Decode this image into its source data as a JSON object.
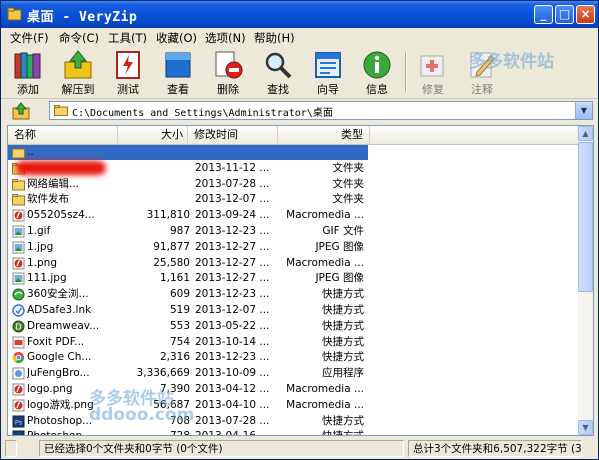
{
  "window": {
    "title": "桌面 - VeryZip"
  },
  "menu": [
    "文件(F)",
    "命令(C)",
    "工具(T)",
    "收藏(O)",
    "选项(N)",
    "帮助(H)"
  ],
  "toolbar": [
    {
      "label": "添加",
      "icon": "add-books-icon"
    },
    {
      "label": "解压到",
      "icon": "extract-folder-icon"
    },
    {
      "label": "测试",
      "icon": "test-icon"
    },
    {
      "label": "查看",
      "icon": "view-book-icon"
    },
    {
      "label": "删除",
      "icon": "delete-icon"
    },
    {
      "label": "查找",
      "icon": "find-magnifier-icon"
    },
    {
      "label": "向导",
      "icon": "wizard-icon"
    },
    {
      "label": "信息",
      "icon": "info-icon"
    },
    {
      "label": "修复",
      "icon": "repair-icon"
    },
    {
      "label": "注释",
      "icon": "comment-icon"
    }
  ],
  "address": {
    "path": "C:\\Documents and Settings\\Administrator\\桌面"
  },
  "columns": {
    "name": "名称",
    "size": "大小",
    "modified": "修改时间",
    "type": "类型"
  },
  "files": [
    {
      "name": "..",
      "size": "",
      "time": "",
      "type": "",
      "icon": "parent-folder-icon"
    },
    {
      "name": "",
      "size": "",
      "time": "2013-11-12 ...",
      "type": "文件夹",
      "icon": "folder-icon"
    },
    {
      "name": "网络编辑...",
      "size": "",
      "time": "2013-07-28 ...",
      "type": "文件夹",
      "icon": "folder-icon"
    },
    {
      "name": "软件发布",
      "size": "",
      "time": "2013-12-07 ...",
      "type": "文件夹",
      "icon": "folder-icon"
    },
    {
      "name": "055205sz4...",
      "size": "311,810",
      "time": "2013-09-24 ...",
      "type": "Macromedia ...",
      "icon": "flash-icon"
    },
    {
      "name": "1.gif",
      "size": "987",
      "time": "2013-12-23 ...",
      "type": "GIF 文件",
      "icon": "image-icon"
    },
    {
      "name": "1.jpg",
      "size": "91,877",
      "time": "2013-12-27 ...",
      "type": "JPEG 图像",
      "icon": "image-icon"
    },
    {
      "name": "1.png",
      "size": "25,580",
      "time": "2013-12-27 ...",
      "type": "Macromedia ...",
      "icon": "flash-icon"
    },
    {
      "name": "111.jpg",
      "size": "1,161",
      "time": "2013-12-27 ...",
      "type": "JPEG 图像",
      "icon": "image-icon"
    },
    {
      "name": "360安全浏...",
      "size": "609",
      "time": "2013-12-23 ...",
      "type": "快捷方式",
      "icon": "browser-360-icon"
    },
    {
      "name": "ADSafe3.lnk",
      "size": "519",
      "time": "2013-12-07 ...",
      "type": "快捷方式",
      "icon": "shield-icon"
    },
    {
      "name": "Dreamweav...",
      "size": "553",
      "time": "2013-05-22 ...",
      "type": "快捷方式",
      "icon": "dreamweaver-icon"
    },
    {
      "name": "Foxit PDF...",
      "size": "754",
      "time": "2013-10-14 ...",
      "type": "快捷方式",
      "icon": "pdf-icon"
    },
    {
      "name": "Google Ch...",
      "size": "2,316",
      "time": "2013-12-23 ...",
      "type": "快捷方式",
      "icon": "chrome-icon"
    },
    {
      "name": "JuFengBro...",
      "size": "3,336,669",
      "time": "2013-10-09 ...",
      "type": "应用程序",
      "icon": "app-icon"
    },
    {
      "name": "logo.png",
      "size": "7,390",
      "time": "2013-04-12 ...",
      "type": "Macromedia ...",
      "icon": "flash-icon"
    },
    {
      "name": "logo游戏.png",
      "size": "56,687",
      "time": "2013-04-10 ...",
      "type": "Macromedia ...",
      "icon": "flash-icon"
    },
    {
      "name": "Photoshop...",
      "size": "708",
      "time": "2013-07-28 ...",
      "type": "快捷方式",
      "icon": "photoshop-icon"
    },
    {
      "name": "Photoshop...",
      "size": "728",
      "time": "2013-04-16 ...",
      "type": "快捷方式",
      "icon": "photoshop-icon"
    }
  ],
  "status": {
    "left": "已经选择0个文件夹和0字节 (0个文件)",
    "right": "总计3个文件夹和6,507,322字节 (3"
  },
  "watermark": {
    "top": "多多软件站",
    "bottom_cn": "多多软件站",
    "bottom_url": "ddooo.com"
  }
}
